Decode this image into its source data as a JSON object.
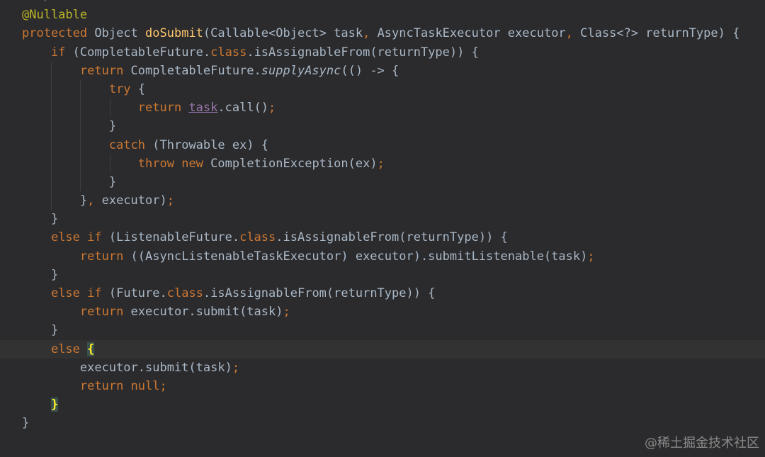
{
  "editor": {
    "lines": [
      {
        "segments": [
          {
            "t": "  */",
            "c": "cm"
          }
        ]
      },
      {
        "segments": [
          {
            "t": "@Nullable",
            "c": "ann"
          }
        ]
      },
      {
        "segments": [
          {
            "t": "protected",
            "c": "kw"
          },
          {
            "t": " Object ",
            "c": ""
          },
          {
            "t": "doSubmit",
            "c": "fn"
          },
          {
            "t": "(Callable<Object> task",
            "c": ""
          },
          {
            "t": ",",
            "c": "punc"
          },
          {
            "t": " AsyncTaskExecutor executor",
            "c": ""
          },
          {
            "t": ",",
            "c": "punc"
          },
          {
            "t": " Class<?> returnType) {",
            "c": ""
          }
        ]
      },
      {
        "segments": [
          {
            "t": "    ",
            "c": ""
          },
          {
            "t": "if",
            "c": "kw"
          },
          {
            "t": " (CompletableFuture.",
            "c": ""
          },
          {
            "t": "class",
            "c": "kw"
          },
          {
            "t": ".isAssignableFrom(returnType)) {",
            "c": ""
          }
        ]
      },
      {
        "segments": [
          {
            "t": "        ",
            "c": ""
          },
          {
            "t": "return",
            "c": "kw"
          },
          {
            "t": " CompletableFuture.",
            "c": ""
          },
          {
            "t": "supplyAsync",
            "c": "it"
          },
          {
            "t": "(() -> {",
            "c": ""
          }
        ]
      },
      {
        "segments": [
          {
            "t": "            ",
            "c": ""
          },
          {
            "t": "try",
            "c": "kw"
          },
          {
            "t": " {",
            "c": ""
          }
        ]
      },
      {
        "segments": [
          {
            "t": "                ",
            "c": ""
          },
          {
            "t": "return",
            "c": "kw"
          },
          {
            "t": " ",
            "c": ""
          },
          {
            "t": "task",
            "c": "field"
          },
          {
            "t": ".call()",
            "c": ""
          },
          {
            "t": ";",
            "c": "punc"
          }
        ]
      },
      {
        "segments": [
          {
            "t": "            }",
            "c": ""
          }
        ]
      },
      {
        "segments": [
          {
            "t": "            ",
            "c": ""
          },
          {
            "t": "catch",
            "c": "kw"
          },
          {
            "t": " (Throwable ex) {",
            "c": ""
          }
        ]
      },
      {
        "segments": [
          {
            "t": "                ",
            "c": ""
          },
          {
            "t": "throw",
            "c": "kw"
          },
          {
            "t": " ",
            "c": ""
          },
          {
            "t": "new",
            "c": "kw"
          },
          {
            "t": " CompletionException(ex)",
            "c": ""
          },
          {
            "t": ";",
            "c": "punc"
          }
        ]
      },
      {
        "segments": [
          {
            "t": "            }",
            "c": ""
          }
        ]
      },
      {
        "segments": [
          {
            "t": "        }",
            "c": ""
          },
          {
            "t": ",",
            "c": "punc"
          },
          {
            "t": " executor)",
            "c": ""
          },
          {
            "t": ";",
            "c": "punc"
          }
        ]
      },
      {
        "segments": [
          {
            "t": "    }",
            "c": ""
          }
        ]
      },
      {
        "segments": [
          {
            "t": "    ",
            "c": ""
          },
          {
            "t": "else if",
            "c": "kw"
          },
          {
            "t": " (ListenableFuture.",
            "c": ""
          },
          {
            "t": "class",
            "c": "kw"
          },
          {
            "t": ".isAssignableFrom(returnType)) {",
            "c": ""
          }
        ]
      },
      {
        "segments": [
          {
            "t": "        ",
            "c": ""
          },
          {
            "t": "return",
            "c": "kw"
          },
          {
            "t": " ((AsyncListenableTaskExecutor) executor).submitListenable(task)",
            "c": ""
          },
          {
            "t": ";",
            "c": "punc"
          }
        ]
      },
      {
        "segments": [
          {
            "t": "    }",
            "c": ""
          }
        ]
      },
      {
        "segments": [
          {
            "t": "    ",
            "c": ""
          },
          {
            "t": "else if",
            "c": "kw"
          },
          {
            "t": " (Future.",
            "c": ""
          },
          {
            "t": "class",
            "c": "kw"
          },
          {
            "t": ".isAssignableFrom(returnType)) {",
            "c": ""
          }
        ]
      },
      {
        "segments": [
          {
            "t": "        ",
            "c": ""
          },
          {
            "t": "return",
            "c": "kw"
          },
          {
            "t": " executor.submit(task)",
            "c": ""
          },
          {
            "t": ";",
            "c": "punc"
          }
        ]
      },
      {
        "segments": [
          {
            "t": "    }",
            "c": ""
          }
        ]
      },
      {
        "current": true,
        "segments": [
          {
            "t": "    ",
            "c": ""
          },
          {
            "t": "else",
            "c": "kw"
          },
          {
            "t": " ",
            "c": ""
          },
          {
            "t": "{",
            "c": "brace-hl"
          }
        ]
      },
      {
        "segments": [
          {
            "t": "        executor.submit(task)",
            "c": ""
          },
          {
            "t": ";",
            "c": "punc"
          }
        ]
      },
      {
        "segments": [
          {
            "t": "        ",
            "c": ""
          },
          {
            "t": "return",
            "c": "kw"
          },
          {
            "t": " ",
            "c": ""
          },
          {
            "t": "null",
            "c": "kw"
          },
          {
            "t": ";",
            "c": "punc"
          }
        ]
      },
      {
        "segments": [
          {
            "t": "    ",
            "c": ""
          },
          {
            "t": "}",
            "c": "brace-hl"
          }
        ]
      },
      {
        "segments": [
          {
            "t": "}",
            "c": ""
          }
        ]
      }
    ]
  },
  "watermark": "@稀土掘金技术社区"
}
